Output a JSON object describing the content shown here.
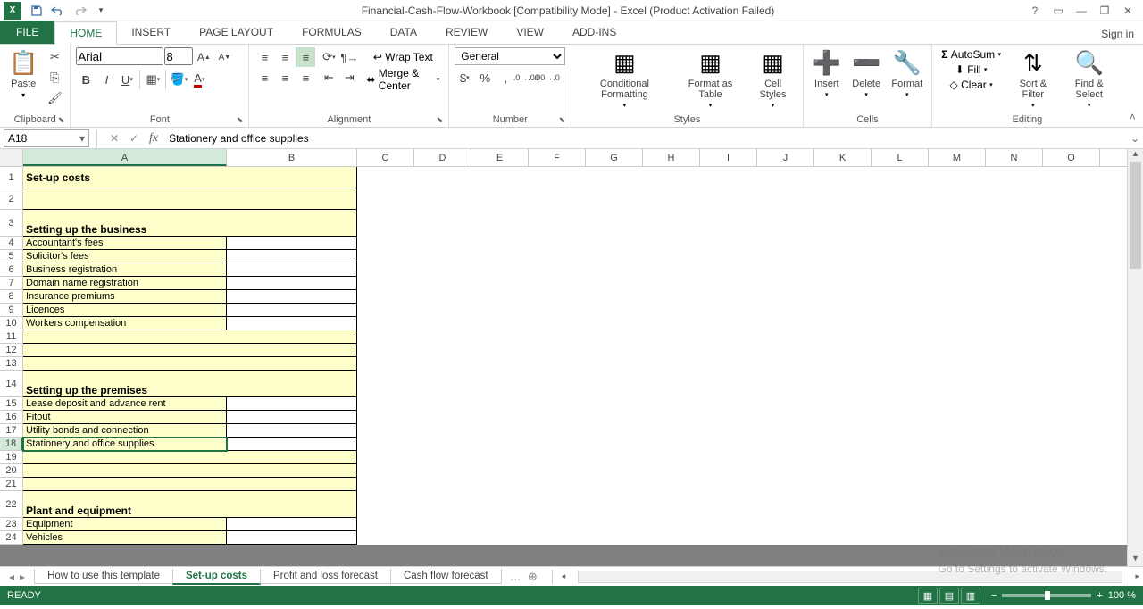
{
  "title": "Financial-Cash-Flow-Workbook  [Compatibility Mode] - Excel (Product Activation Failed)",
  "signin": "Sign in",
  "tabs": {
    "file": "FILE",
    "home": "HOME",
    "insert": "INSERT",
    "page_layout": "PAGE LAYOUT",
    "formulas": "FORMULAS",
    "data": "DATA",
    "review": "REVIEW",
    "view": "VIEW",
    "addins": "ADD-INS"
  },
  "ribbon": {
    "clipboard": {
      "label": "Clipboard",
      "paste": "Paste"
    },
    "font": {
      "label": "Font",
      "name": "Arial",
      "size": "8"
    },
    "alignment": {
      "label": "Alignment",
      "wrap": "Wrap Text",
      "merge": "Merge & Center"
    },
    "number": {
      "label": "Number",
      "format": "General"
    },
    "styles": {
      "label": "Styles",
      "cond": "Conditional Formatting",
      "table": "Format as Table",
      "cell": "Cell Styles"
    },
    "cells": {
      "label": "Cells",
      "insert": "Insert",
      "delete": "Delete",
      "format": "Format"
    },
    "editing": {
      "label": "Editing",
      "autosum": "AutoSum",
      "fill": "Fill",
      "clear": "Clear",
      "sort": "Sort & Filter",
      "find": "Find & Select"
    }
  },
  "namebox": "A18",
  "formula": "Stationery and office supplies",
  "columns": [
    "A",
    "B",
    "C",
    "D",
    "E",
    "F",
    "G",
    "H",
    "I",
    "J",
    "K",
    "L",
    "M",
    "N",
    "O"
  ],
  "col_widths": {
    "A": 228,
    "B": 146,
    "other": 64
  },
  "selected_cell": {
    "row": 18,
    "col": "A"
  },
  "rows": [
    {
      "n": 1,
      "h": "big",
      "a": "Set-up costs",
      "style": "header-cell",
      "merged": true
    },
    {
      "n": 2,
      "h": "big",
      "a": "",
      "merged": true
    },
    {
      "n": 3,
      "h": "extra",
      "a": "Setting up the business",
      "style": "subheader",
      "merged": true
    },
    {
      "n": 4,
      "a": "Accountant's fees"
    },
    {
      "n": 5,
      "a": "Solicitor's fees"
    },
    {
      "n": 6,
      "a": "Business registration"
    },
    {
      "n": 7,
      "a": "Domain name registration"
    },
    {
      "n": 8,
      "a": "Insurance premiums"
    },
    {
      "n": 9,
      "a": "Licences"
    },
    {
      "n": 10,
      "a": "Workers compensation"
    },
    {
      "n": 11,
      "a": "",
      "merged": true
    },
    {
      "n": 12,
      "a": "",
      "merged": true
    },
    {
      "n": 13,
      "a": "",
      "merged": true
    },
    {
      "n": 14,
      "h": "extra",
      "a": "Setting up the premises",
      "style": "subheader",
      "merged": true
    },
    {
      "n": 15,
      "a": "Lease deposit and advance rent"
    },
    {
      "n": 16,
      "a": "Fitout"
    },
    {
      "n": 17,
      "a": "Utility bonds and connection"
    },
    {
      "n": 18,
      "a": "Stationery and office supplies"
    },
    {
      "n": 19,
      "a": "",
      "merged": true
    },
    {
      "n": 20,
      "a": "",
      "merged": true
    },
    {
      "n": 21,
      "a": "",
      "merged": true
    },
    {
      "n": 22,
      "h": "extra",
      "a": "Plant and equipment",
      "style": "subheader",
      "merged": true
    },
    {
      "n": 23,
      "a": "Equipment"
    },
    {
      "n": 24,
      "a": "Vehicles"
    }
  ],
  "sheets": {
    "howto": "How to use this template",
    "setup": "Set-up costs",
    "pl": "Profit and loss forecast",
    "cf": "Cash flow forecast"
  },
  "status": {
    "ready": "READY",
    "zoom": "100 %"
  },
  "watermark": {
    "title": "Activate Windows",
    "sub": "Go to Settings to activate Windows."
  }
}
